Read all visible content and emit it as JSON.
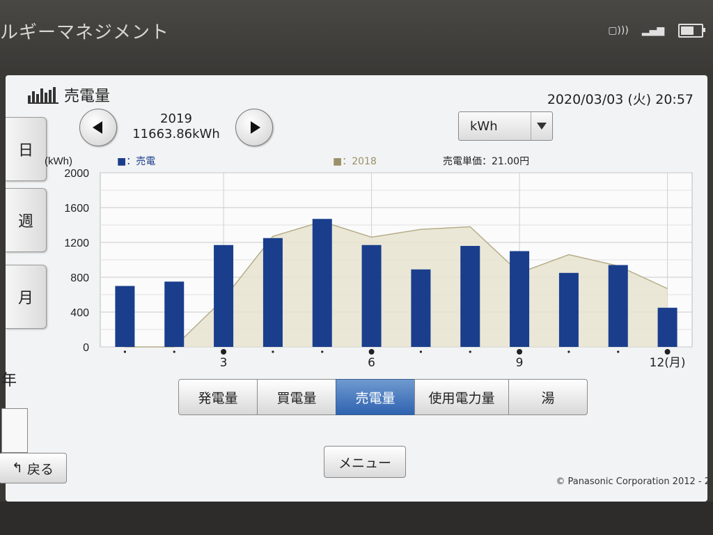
{
  "app": {
    "title": "ルギーマネジメント"
  },
  "screen": {
    "title": "売電量",
    "datetime": "2020/03/03 (火) 20:57",
    "side_tabs": [
      "日",
      "週",
      "月"
    ],
    "year_tab": "年",
    "year": "2019",
    "total": "11663.86kWh",
    "unit": "kWh",
    "categories": [
      "発電量",
      "買電量",
      "売電量",
      "使用電力量",
      "湯"
    ],
    "active_category": "売電量",
    "back_label": "戻る",
    "menu_label": "メニュー",
    "copyright": "© Panasonic Corporation 2012 - 2"
  },
  "chart_data": {
    "type": "bar",
    "ylabel": "(kWh)",
    "ylim": [
      0,
      2000
    ],
    "yticks": [
      0,
      400,
      800,
      1200,
      1600,
      2000
    ],
    "x": [
      1,
      2,
      3,
      4,
      5,
      6,
      7,
      8,
      9,
      10,
      11,
      12
    ],
    "x_tick_labels": [
      "",
      "",
      "3",
      "",
      "",
      "6",
      "",
      "",
      "9",
      "",
      "",
      "12(月)"
    ],
    "legend": {
      "series_label": "■：売電",
      "compare_label": "■：2018",
      "unit_price": "売電単価：21.00円"
    },
    "series": [
      {
        "name": "売電",
        "color": "#1a3e8c",
        "values": [
          700,
          750,
          1170,
          1250,
          1470,
          1170,
          890,
          1160,
          1100,
          850,
          940,
          450
        ]
      },
      {
        "name": "2018",
        "color": "#b5ad88",
        "fill": "#e6e3d0",
        "values": [
          0,
          0,
          550,
          1270,
          1440,
          1260,
          1350,
          1380,
          850,
          1060,
          930,
          670
        ]
      }
    ]
  }
}
